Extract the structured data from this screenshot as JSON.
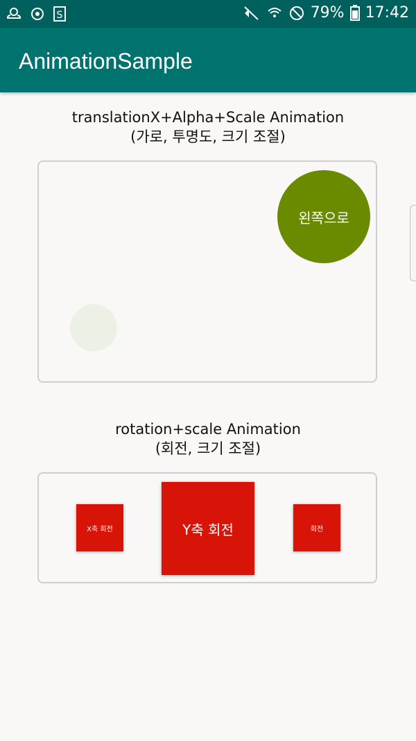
{
  "status_bar": {
    "left_icons": [
      "weather-icon",
      "sync-icon",
      "s-app-icon"
    ],
    "battery": "79%",
    "time": "17:42"
  },
  "app_bar": {
    "title": "AnimationSample"
  },
  "sections": [
    {
      "title_line1": "translationX+Alpha+Scale Animation",
      "title_line2": "(가로, 투명도, 크기 조절)",
      "moving_circle_label": "왼쪽으로"
    },
    {
      "title_line1": "rotation+scale Animation",
      "title_line2": "(회전, 크기 조절)",
      "x_rotate_label": "X축 회전",
      "y_rotate_label": "Y축 회전",
      "rotate_label": "회전"
    }
  ],
  "colors": {
    "status_bar": "#00605d",
    "app_bar": "#00736f",
    "circle": "#6a8a00",
    "ghost_circle": "#edf0e4",
    "squares": "#d81408"
  }
}
